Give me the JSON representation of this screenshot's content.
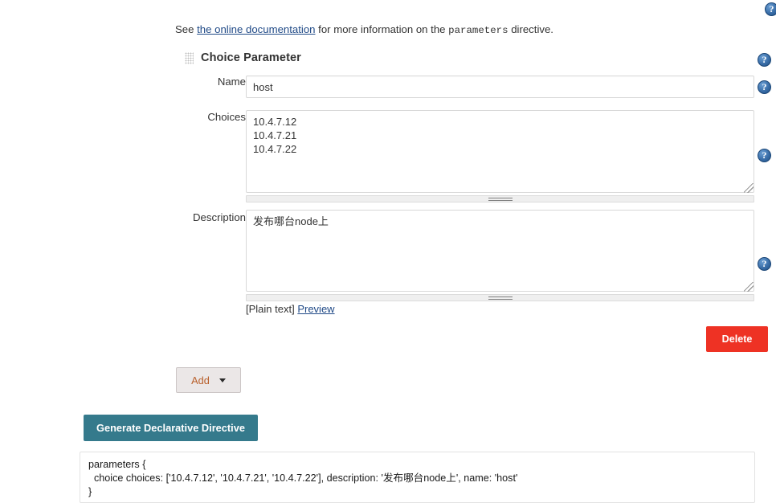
{
  "intro": {
    "prefix": "See ",
    "link_text": "the online documentation",
    "middle": " for more information on the ",
    "code_term": "parameters",
    "suffix": " directive."
  },
  "section": {
    "title": "Choice Parameter",
    "grip_icon": "drag-handle-icon"
  },
  "form": {
    "name_label": "Name",
    "name_value": "host",
    "choices_label": "Choices",
    "choices_value": "10.4.7.12\n10.4.7.21\n10.4.7.22",
    "description_label": "Description",
    "description_value": "发布哪台node上"
  },
  "preview": {
    "plain_text": "[Plain text]",
    "preview_link": "Preview"
  },
  "buttons": {
    "delete_label": "Delete",
    "add_label": "Add",
    "add_caret_icon": "chevron-down-icon",
    "generate_label": "Generate Declarative Directive"
  },
  "generated_code": "parameters {\n  choice choices: ['10.4.7.12', '10.4.7.21', '10.4.7.22'], description: '发布哪台node上', name: 'host'\n}",
  "help_icons": {
    "label": "?",
    "semantic": "help-icon",
    "count": 5
  },
  "colors": {
    "delete_red": "#ee3224",
    "generate_teal": "#357a8c",
    "link_blue": "#204a87",
    "add_button_text": "#b9602c"
  }
}
